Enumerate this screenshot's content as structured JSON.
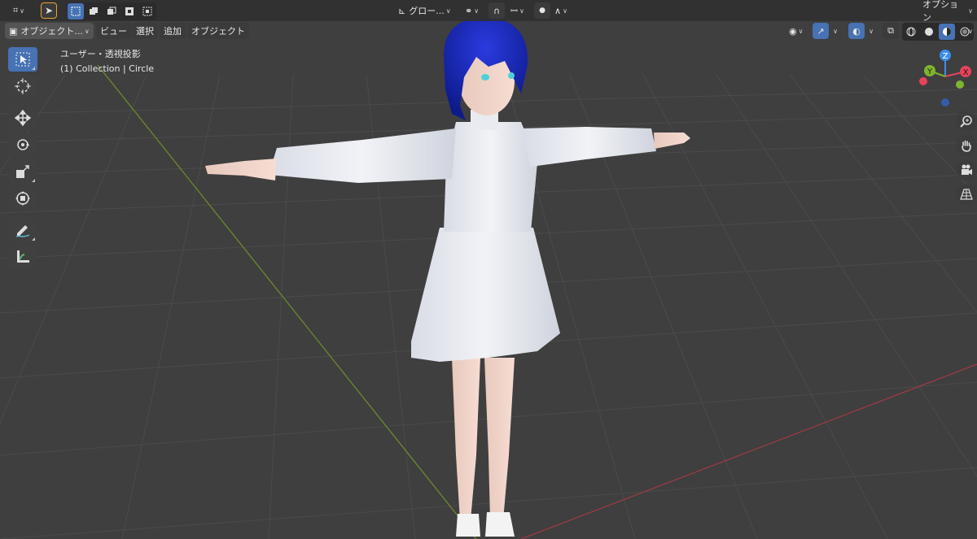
{
  "header": {
    "transform_orientation": "グロー...",
    "options_label": "オプション"
  },
  "menubar": {
    "mode": "オブジェクト...",
    "items": [
      "ビュー",
      "選択",
      "追加",
      "オブジェクト"
    ]
  },
  "viewport": {
    "view_name": "ユーザー・透視投影",
    "collection_info": "(1) Collection | Circle"
  },
  "gizmo": {
    "axes": [
      "Z",
      "Y",
      "X"
    ],
    "colors": {
      "x": "#e8425a",
      "y": "#7fb52c",
      "z": "#3b8eed"
    }
  },
  "toolbar": {
    "tools": [
      "select-box-tool",
      "cursor-tool",
      "move-tool",
      "rotate-tool",
      "scale-tool",
      "transform-tool",
      "annotate-tool",
      "measure-tool"
    ]
  },
  "nav": [
    "zoom-icon",
    "hand-pan-icon",
    "camera-icon",
    "grid-perspective-icon"
  ],
  "colors": {
    "accent": "#4772b3",
    "background": "#3f3f3f",
    "header": "#303030"
  }
}
